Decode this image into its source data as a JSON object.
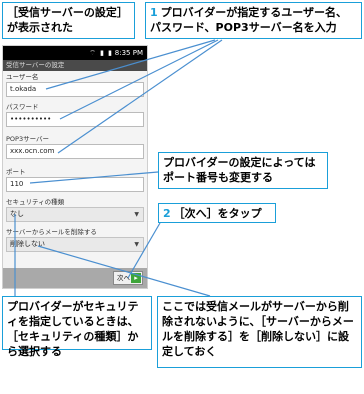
{
  "callouts": {
    "displayed": "［受信サーバーの設定］が表示された",
    "step1_num": "1",
    "step1_text": "プロバイダーが指定するユーザー名、パスワード、POP3サーバー名を入力",
    "port_note": "プロバイダーの設定によってはポート番号も変更する",
    "step2_num": "2",
    "step2_text": "［次へ］をタップ",
    "security_note": "プロバイダーがセキュリティを指定しているときは、［セキュリティの種類］から選択する",
    "delete_note": "ここでは受信メールがサーバーから削除されないように、［サーバーからメールを削除する］を［削除しない］に設定しておく"
  },
  "phone": {
    "status_time": "8:35 PM",
    "status_icons": "⌔ ▮ ▮",
    "title": "受信サーバーの設定",
    "username_label": "ユーザー名",
    "username_value": "t.okada",
    "password_label": "パスワード",
    "password_value": "••••••••••",
    "server_label": "POP3サーバー",
    "server_value": "xxx.ocn.com",
    "port_label": "ポート",
    "port_value": "110",
    "security_label": "セキュリティの種類",
    "security_value": "なし",
    "delete_label": "サーバーからメールを削除する",
    "delete_value": "削除しない",
    "next_button": "次へ",
    "next_icon": "▸"
  },
  "colors": {
    "accent": "#1a9fd9",
    "leader_line": "#4a8fd0",
    "next_green": "#3ea53a"
  }
}
